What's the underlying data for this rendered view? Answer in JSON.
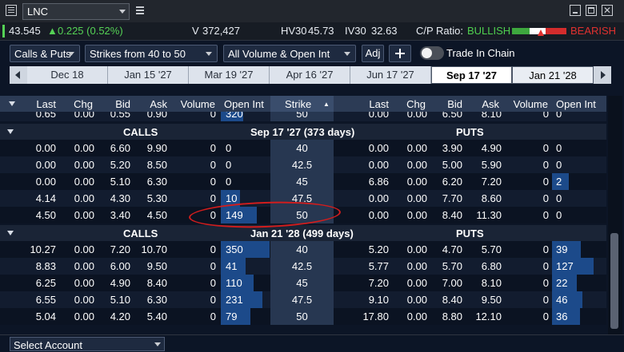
{
  "titlebar": {
    "symbol": "LNC"
  },
  "quote": {
    "last": "43.545",
    "change": "0.225 (0.52%)",
    "volume_label": "V",
    "volume": "372,427",
    "hv30_label": "HV30",
    "hv30": "45.73",
    "iv30_label": "IV30",
    "iv30": "32.63",
    "cp_label": "C/P Ratio:",
    "bullish": "BULLISH",
    "bearish": "BEARISH"
  },
  "toolbar": {
    "type_select": "Calls & Puts",
    "strike_select": "Strikes from 40 to 50",
    "volume_select": "All Volume & Open Int",
    "adj": "Adj",
    "trade_in_chain": "Trade In Chain"
  },
  "expirations": [
    "Dec 18",
    "Jan 15 '27",
    "Mar 19 '27",
    "Apr 16 '27",
    "Jun 17 '27",
    "Sep 17 '27",
    "Jan 21 '28"
  ],
  "selected_expiration": "Sep 17 '27",
  "columns": {
    "calls": [
      "Last",
      "Chg",
      "Bid",
      "Ask",
      "Volume",
      "Open Int"
    ],
    "strike": "Strike",
    "puts": [
      "Last",
      "Chg",
      "Bid",
      "Ask",
      "Volume",
      "Open Int"
    ]
  },
  "top_partial_row": {
    "calls": [
      "0.65",
      "0.00",
      "0.55",
      "0.90",
      "0",
      "320"
    ],
    "strike": "50",
    "puts": [
      "0.00",
      "0.00",
      "6.50",
      "8.10",
      "0",
      "0"
    ]
  },
  "sections": [
    {
      "calls_label": "CALLS",
      "title": "Sep 17 '27 (373 days)",
      "puts_label": "PUTS",
      "rows": [
        {
          "calls": [
            "0.00",
            "0.00",
            "6.60",
            "9.90",
            "0",
            "0"
          ],
          "strike": "40",
          "puts": [
            "0.00",
            "0.00",
            "3.90",
            "4.90",
            "0",
            "0"
          ]
        },
        {
          "calls": [
            "0.00",
            "0.00",
            "5.20",
            "8.50",
            "0",
            "0"
          ],
          "strike": "42.5",
          "puts": [
            "0.00",
            "0.00",
            "5.00",
            "5.90",
            "0",
            "0"
          ]
        },
        {
          "calls": [
            "0.00",
            "0.00",
            "5.10",
            "6.30",
            "0",
            "0"
          ],
          "strike": "45",
          "puts": [
            "6.86",
            "0.00",
            "6.20",
            "7.20",
            "0",
            "2"
          ]
        },
        {
          "calls": [
            "4.14",
            "0.00",
            "4.30",
            "5.30",
            "0",
            "10"
          ],
          "strike": "47.5",
          "puts": [
            "0.00",
            "0.00",
            "7.70",
            "8.60",
            "0",
            "0"
          ]
        },
        {
          "calls": [
            "4.50",
            "0.00",
            "3.40",
            "4.50",
            "0",
            "149"
          ],
          "strike": "50",
          "puts": [
            "0.00",
            "0.00",
            "8.40",
            "11.30",
            "0",
            "0"
          ]
        }
      ]
    },
    {
      "calls_label": "CALLS",
      "title": "Jan 21 '28 (499 days)",
      "puts_label": "PUTS",
      "rows": [
        {
          "calls": [
            "10.27",
            "0.00",
            "7.20",
            "10.70",
            "0",
            "350"
          ],
          "strike": "40",
          "puts": [
            "5.20",
            "0.00",
            "4.70",
            "5.70",
            "0",
            "39"
          ]
        },
        {
          "calls": [
            "8.83",
            "0.00",
            "6.00",
            "9.50",
            "0",
            "41"
          ],
          "strike": "42.5",
          "puts": [
            "5.77",
            "0.00",
            "5.70",
            "6.80",
            "0",
            "127"
          ]
        },
        {
          "calls": [
            "6.25",
            "0.00",
            "4.90",
            "8.40",
            "0",
            "110"
          ],
          "strike": "45",
          "puts": [
            "7.20",
            "0.00",
            "7.00",
            "8.10",
            "0",
            "22"
          ]
        },
        {
          "calls": [
            "6.55",
            "0.00",
            "5.10",
            "6.30",
            "0",
            "231"
          ],
          "strike": "47.5",
          "puts": [
            "9.10",
            "0.00",
            "8.40",
            "9.50",
            "0",
            "46"
          ]
        },
        {
          "calls": [
            "5.04",
            "0.00",
            "4.20",
            "5.40",
            "0",
            "79"
          ],
          "strike": "50",
          "puts": [
            "17.80",
            "0.00",
            "8.80",
            "12.10",
            "0",
            "36"
          ]
        }
      ]
    }
  ],
  "footer": {
    "account_select": "Select Account"
  },
  "colors": {
    "accent": "#1c4a8a",
    "positive": "#55d255",
    "bearish": "#e0312f",
    "annotation": "#d21d1d"
  }
}
